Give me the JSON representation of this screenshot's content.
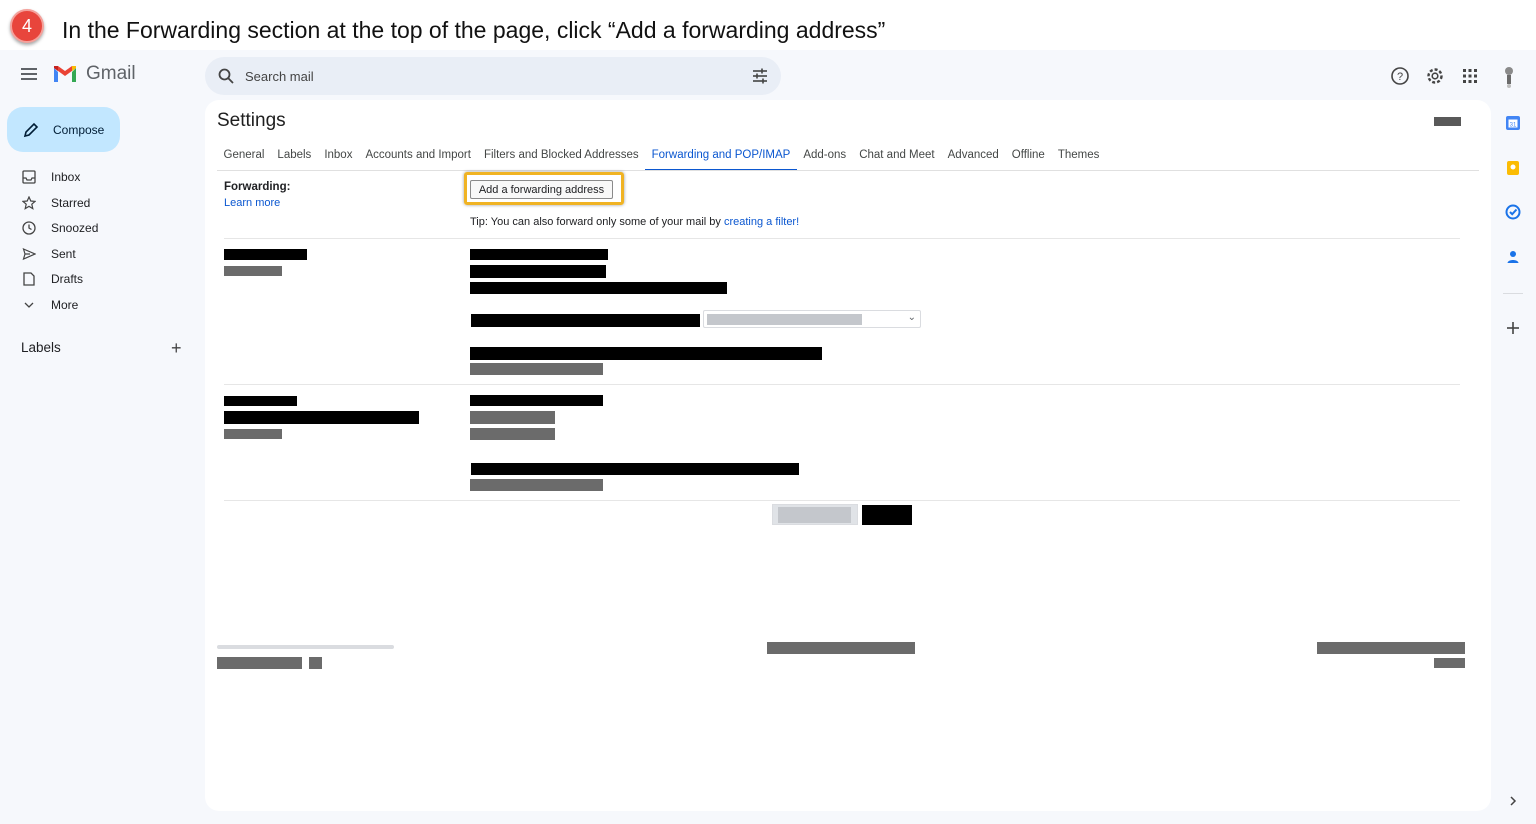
{
  "instruction": {
    "step": "4",
    "text": "In the Forwarding section at the top of the page, click “Add a forwarding address”"
  },
  "app": {
    "name": "Gmail",
    "search_placeholder": "Search mail"
  },
  "compose": {
    "label": "Compose"
  },
  "sidebar": {
    "items": [
      {
        "label": "Inbox",
        "icon": "inbox-icon"
      },
      {
        "label": "Starred",
        "icon": "star-icon"
      },
      {
        "label": "Snoozed",
        "icon": "clock-icon"
      },
      {
        "label": "Sent",
        "icon": "send-icon"
      },
      {
        "label": "Drafts",
        "icon": "draft-icon"
      },
      {
        "label": "More",
        "icon": "chevron-down-icon"
      }
    ],
    "labels_heading": "Labels",
    "labels_add": "+"
  },
  "settings": {
    "title": "Settings",
    "tabs": [
      "General",
      "Labels",
      "Inbox",
      "Accounts and Import",
      "Filters and Blocked Addresses",
      "Forwarding and POP/IMAP",
      "Add-ons",
      "Chat and Meet",
      "Advanced",
      "Offline",
      "Themes"
    ],
    "active_tab": "Forwarding and POP/IMAP",
    "forwarding": {
      "label": "Forwarding:",
      "learn_more": "Learn more",
      "button": "Add a forwarding address",
      "tip_prefix": "Tip: You can also forward only some of your mail by ",
      "tip_link": "creating a filter!"
    }
  },
  "colors": {
    "accent": "#0b57d0",
    "compose_bg": "#c2e7ff",
    "highlight": "#f0b323",
    "step_badge": "#e8453c"
  }
}
